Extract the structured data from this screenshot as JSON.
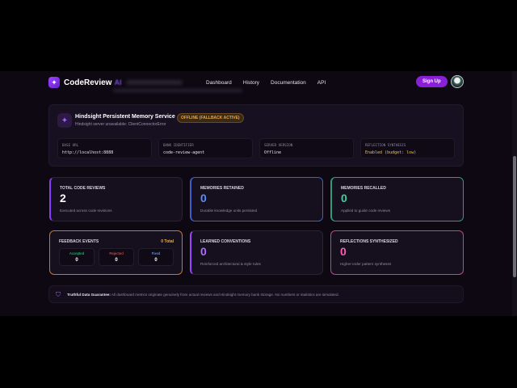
{
  "nav": {
    "brand": "CodeReview",
    "brand_suffix": "AI",
    "links": [
      "Dashboard",
      "History",
      "Documentation",
      "API"
    ],
    "signup": "Sign Up"
  },
  "service": {
    "title": "Hindsight Persistent Memory Service",
    "badge": "OFFLINE (FALLBACK ACTIVE)",
    "subtitle": "Hindsight server unavailable: ClientConnectorError",
    "boxes": [
      {
        "label": "BASE URL",
        "value": "http://localhost:8888"
      },
      {
        "label": "BANK IDENTIFIER",
        "value": "code-review-agent"
      },
      {
        "label": "SERVER VERSION",
        "value": "Offline"
      },
      {
        "label": "REFLECTION SYNTHESIS",
        "value": "Enabled (budget: low)"
      }
    ]
  },
  "cards": {
    "total_reviews": {
      "label": "TOTAL CODE REVIEWS",
      "value": "2",
      "desc": "Executed across code revisions",
      "color": "#ffffff"
    },
    "memories_retained": {
      "label": "MEMORIES RETAINED",
      "value": "0",
      "desc": "Durable knowledge units persisted",
      "color": "#5b8cff"
    },
    "memories_recalled": {
      "label": "MEMORIES RECALLED",
      "value": "0",
      "desc": "Applied to guide code reviews",
      "color": "#39d39a"
    },
    "feedback": {
      "label": "FEEDBACK EVENTS",
      "total": "0 Total",
      "items": [
        {
          "label": "Accepted",
          "value": "0",
          "color": "#3ddc84"
        },
        {
          "label": "Rejected",
          "value": "0",
          "color": "#ff5a5a"
        },
        {
          "label": "Fixed",
          "value": "0",
          "color": "#8fb8ff"
        }
      ]
    },
    "conventions": {
      "label": "LEARNED CONVENTIONS",
      "value": "0",
      "desc": "Reinforced architectural & style rules",
      "color": "#b06cff"
    },
    "reflections": {
      "label": "REFLECTIONS SYNTHESIZED",
      "value": "0",
      "desc": "Higher-order pattern syntheses",
      "color": "#ff5fae"
    }
  },
  "guarantee": {
    "title": "Truthful Data Guarantee:",
    "text": "All dashboard metrics originate genuinely from actual reviews and Hindsight memory bank storage. No numbers or statistics are simulated."
  }
}
